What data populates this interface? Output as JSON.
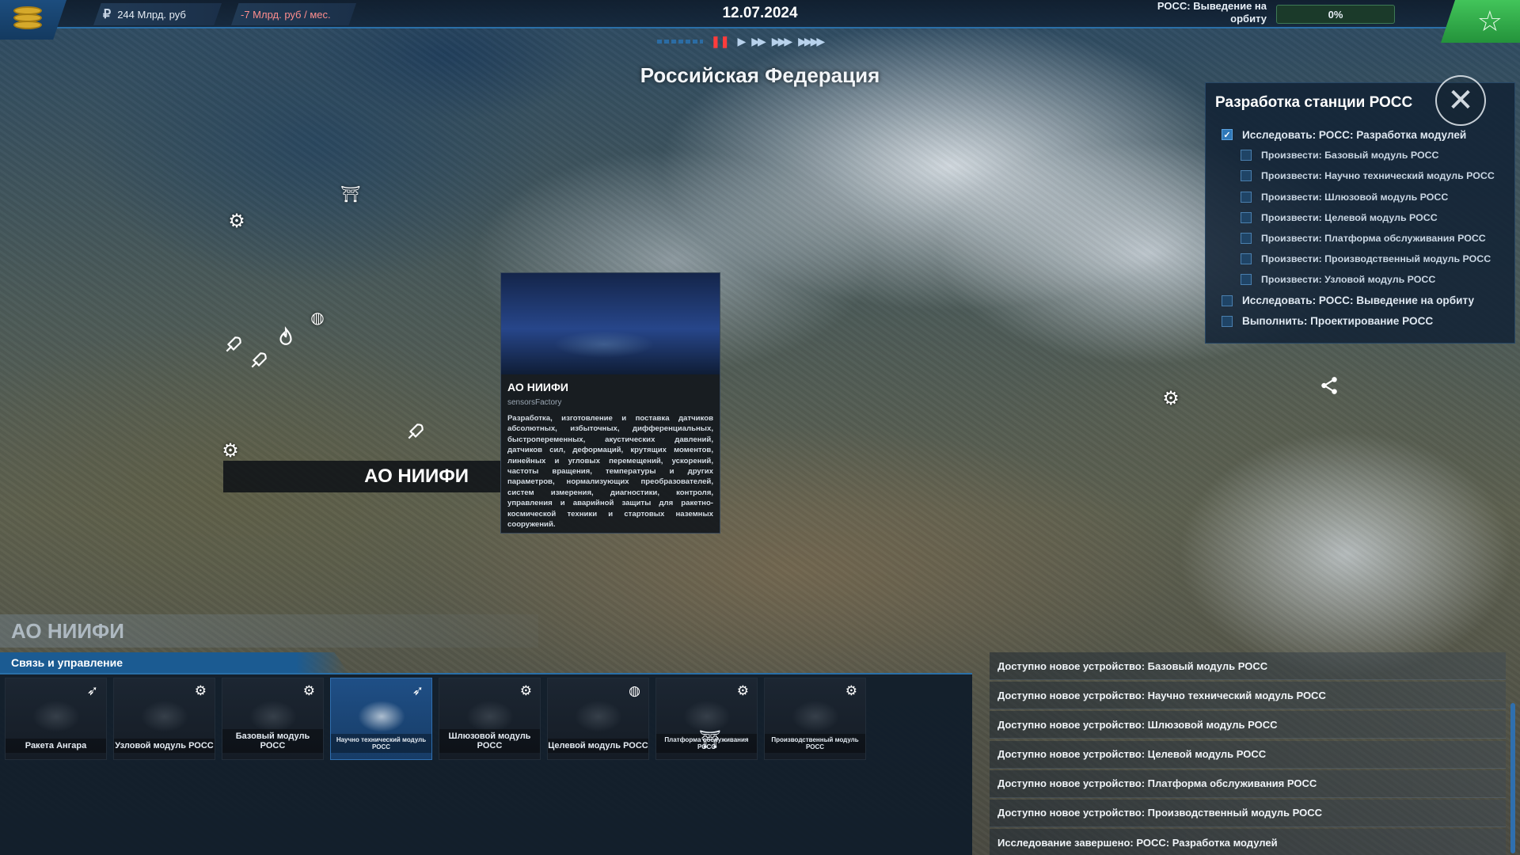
{
  "top_bar": {
    "balance": "244 Млрд. руб",
    "expense": "-7 Млрд. руб / мес.",
    "date": "12.07.2024",
    "goal_label": "РОСС: Выведение на орбиту",
    "goal_progress_text": "0%",
    "goal_progress_value": 0,
    "currency_icon": "ruble-icon",
    "star_icon": "star-icon"
  },
  "map": {
    "region_name": "Российская Федерация",
    "selected_location": "АО НИИФИ"
  },
  "info_card": {
    "title": "АО НИИФИ",
    "subtitle": "sensorsFactory",
    "description": "Разработка, изготовление и поставка датчиков абсолютных, избыточных, дифференциальных, быстропеременных, акустических давлений, датчиков сил, деформаций, крутящих моментов, линейных и угловых перемещений, ускорений, частоты вращения, температуры и других параметров, нормализующих преобразователей, систем измерения, диагностики, контроля, управления и аварийной защиты для ракетно-космической техники и стартовых наземных сооружений."
  },
  "task_panel": {
    "heading": "Разработка станции РОСС",
    "tasks": [
      {
        "label": "Исследовать: РОСС: Разработка модулей",
        "checked": true,
        "sub": false
      },
      {
        "label": "Произвести: Базовый модуль РОСС",
        "checked": false,
        "sub": true
      },
      {
        "label": "Произвести: Научно технический модуль РОСС",
        "checked": false,
        "sub": true
      },
      {
        "label": "Произвести: Шлюзовой модуль РОСС",
        "checked": false,
        "sub": true
      },
      {
        "label": "Произвести: Целевой модуль РОСС",
        "checked": false,
        "sub": true
      },
      {
        "label": "Произвести: Платформа обслуживания РОСС",
        "checked": false,
        "sub": true
      },
      {
        "label": "Произвести: Производственный модуль РОСС",
        "checked": false,
        "sub": true
      },
      {
        "label": "Произвести: Узловой модуль РОСС",
        "checked": false,
        "sub": true
      },
      {
        "label": "Исследовать: РОСС: Выведение на орбиту",
        "checked": false,
        "sub": false
      },
      {
        "label": "Выполнить: Проектирование РОСС",
        "checked": false,
        "sub": false
      }
    ]
  },
  "facility_panel": {
    "facility_name": "АО НИИФИ",
    "tab_label": "Связь и управление",
    "cards": [
      {
        "label": "Ракета Ангара",
        "icon": "rocket-icon",
        "selected": false
      },
      {
        "label": "Узловой модуль РОСС",
        "icon": "gear-icon",
        "selected": false
      },
      {
        "label": "Базовый модуль РОСС",
        "icon": "gear-icon",
        "selected": false
      },
      {
        "label": "Научно технический модуль РОСС",
        "icon": "rocket-icon",
        "selected": true
      },
      {
        "label": "Шлюзовой модуль РОСС",
        "icon": "gear-icon",
        "selected": false
      },
      {
        "label": "Целевой модуль РОСС",
        "icon": "globe-icon",
        "selected": false
      },
      {
        "label": "Платформа обслуживания РОСС",
        "icon": "gear-icon",
        "selected": false
      },
      {
        "label": "Производственный модуль РОСС",
        "icon": "gear-icon",
        "selected": false
      }
    ]
  },
  "notifications": [
    "Доступно новое устройство: Базовый модуль РОСС",
    "Доступно новое устройство: Научно технический модуль РОСС",
    "Доступно новое устройство: Шлюзовой модуль РОСС",
    "Доступно новое устройство: Целевой модуль РОСС",
    "Доступно новое устройство: Платформа обслуживания РОСС",
    "Доступно новое устройство: Производственный модуль РОСС",
    "Исследование завершено: РОСС: Разработка модулей"
  ],
  "colors": {
    "accent_blue": "#2a6fa8",
    "goal_green": "#3fa45c",
    "expense_red": "#ff8e8e",
    "pause_red": "#ff3c3c"
  }
}
